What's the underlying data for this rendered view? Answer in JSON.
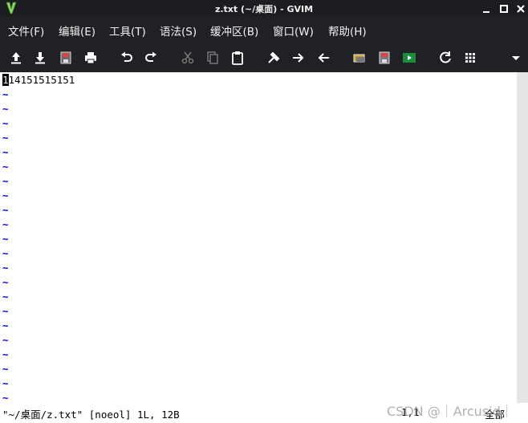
{
  "window": {
    "title": "z.txt (~/桌面) - GVIM",
    "app_icon": "vim-icon",
    "controls": [
      "minimize-icon",
      "maximize-icon",
      "close-icon"
    ]
  },
  "menu": [
    {
      "label": "文件(F)"
    },
    {
      "label": "编辑(E)"
    },
    {
      "label": "工具(T)"
    },
    {
      "label": "语法(S)"
    },
    {
      "label": "缓冲区(B)"
    },
    {
      "label": "窗口(W)"
    },
    {
      "label": "帮助(H)"
    }
  ],
  "toolbar": [
    "open-icon",
    "save-icon",
    "save-all-icon",
    "print-icon",
    "undo-icon",
    "redo-icon",
    "cut-icon",
    "copy-icon",
    "paste-icon",
    "replace-icon",
    "find-next-icon",
    "find-prev-icon",
    "load-session-icon",
    "save-session-icon",
    "run-script-icon",
    "make-icon",
    "tags-icon",
    "overflow-menu-icon"
  ],
  "editor": {
    "lines": [
      "114151515151"
    ],
    "cursor_char": "1",
    "rest_of_first_line": "14151515151",
    "tilde": "~",
    "tilde_count": 22
  },
  "status": {
    "message": "\"~/桌面/z.txt\" [noeol] 1L, 12B",
    "position": "1,1",
    "percent": "全部"
  },
  "watermark": "CSDN @｜Arcusid｜",
  "colors": {
    "chrome_bg": "#1f2124",
    "editor_bg": "#ffffff",
    "tilde": "#0000ff",
    "text": "#000000"
  }
}
